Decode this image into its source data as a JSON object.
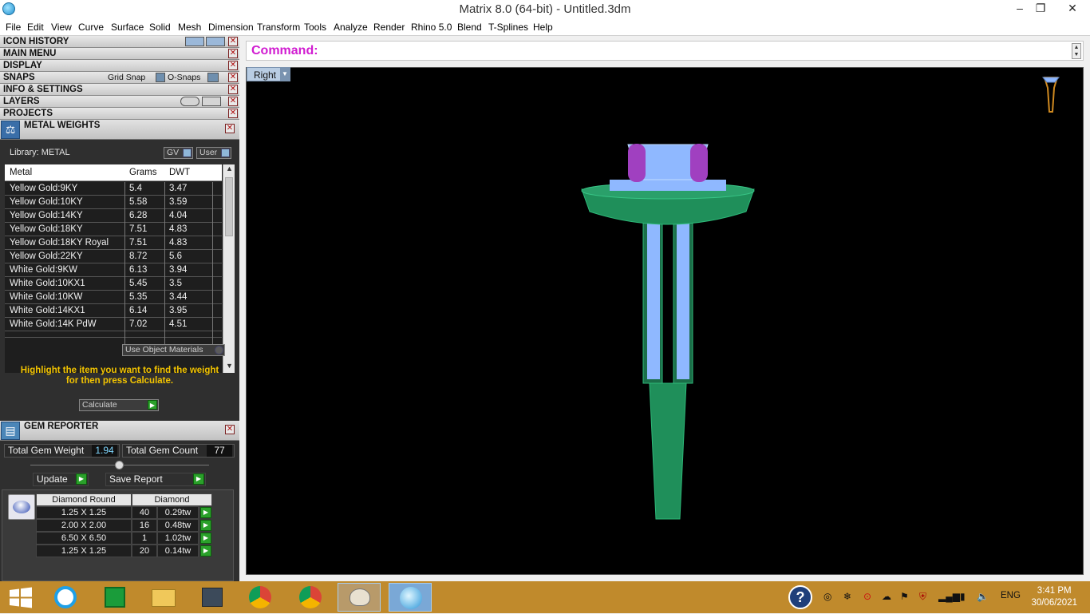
{
  "window": {
    "title": "Matrix 8.0 (64-bit) - Untitled.3dm",
    "minimize": "‒",
    "restore": "❐",
    "close": "✕"
  },
  "menu": [
    "File",
    "Edit",
    "View",
    "Curve",
    "Surface",
    "Solid",
    "Mesh",
    "Dimension",
    "Transform",
    "Tools",
    "Analyze",
    "Render",
    "Rhino 5.0",
    "Blend",
    "T-Splines",
    "Help"
  ],
  "panels": {
    "icon_history": "ICON HISTORY",
    "main_menu": "MAIN MENU",
    "display": "DISPLAY",
    "snaps": "SNAPS",
    "grid_snap": "Grid Snap",
    "o_snaps": "O-Snaps",
    "info_settings": "INFO & SETTINGS",
    "layers": "LAYERS",
    "projects": "PROJECTS"
  },
  "metal_weights": {
    "title": "METAL WEIGHTS",
    "library_label": "Library: METAL",
    "gv": "GV",
    "user": "User",
    "columns": [
      "Metal",
      "Grams",
      "DWT"
    ],
    "rows": [
      [
        "Yellow Gold:9KY",
        "5.4",
        "3.47"
      ],
      [
        "Yellow Gold:10KY",
        "5.58",
        "3.59"
      ],
      [
        "Yellow Gold:14KY",
        "6.28",
        "4.04"
      ],
      [
        "Yellow Gold:18KY",
        "7.51",
        "4.83"
      ],
      [
        "Yellow Gold:18KY Royal",
        "7.51",
        "4.83"
      ],
      [
        "Yellow Gold:22KY",
        "8.72",
        "5.6"
      ],
      [
        "White Gold:9KW",
        "6.13",
        "3.94"
      ],
      [
        "White Gold:10KX1",
        "5.45",
        "3.5"
      ],
      [
        "White Gold:10KW",
        "5.35",
        "3.44"
      ],
      [
        "White Gold:14KX1",
        "6.14",
        "3.95"
      ],
      [
        "White Gold:14K PdW",
        "7.02",
        "4.51"
      ]
    ],
    "use_object_materials": "Use Object Materials",
    "hint_line1": "Highlight the item you want to find the weight",
    "hint_line2": "for then press Calculate.",
    "calculate": "Calculate"
  },
  "gem_reporter": {
    "title": "GEM REPORTER",
    "total_weight_label": "Total Gem Weight",
    "total_weight": "1.94",
    "total_count_label": "Total Gem Count",
    "total_count": "77",
    "update": "Update",
    "save_report": "Save Report",
    "col_shape": "Diamond Round",
    "col_type": "Diamond",
    "rows": [
      [
        "1.25 X 1.25",
        "40",
        "0.29tw"
      ],
      [
        "2.00 X 2.00",
        "16",
        "0.48tw"
      ],
      [
        "6.50 X 6.50",
        "1",
        "1.02tw"
      ],
      [
        "1.25 X 1.25",
        "20",
        "0.14tw"
      ]
    ]
  },
  "command": {
    "label": "Command:"
  },
  "viewport": {
    "name": "Right"
  },
  "taskbar": {
    "lang": "ENG",
    "time": "3:41 PM",
    "date": "30/06/2021"
  },
  "colors": {
    "metal": "#1f8f5a",
    "gem": "#8fb8ff",
    "prong": "#a040c0",
    "taskbar": "#c08a2c",
    "command": "#d11cd1"
  }
}
